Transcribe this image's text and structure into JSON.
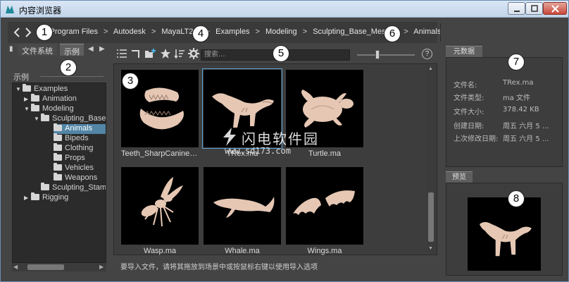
{
  "window": {
    "title": "内容浏览器"
  },
  "pathbar": {
    "crumbs": [
      "Program Files",
      "Autodesk",
      "MayaLT2...",
      "Examples",
      "Modeling",
      "Sculpting_Base_Meshes",
      "Animals"
    ],
    "separator": ">"
  },
  "left_panel": {
    "tabs": [
      "文件系统",
      "示例"
    ],
    "section_label": "示例",
    "tree": [
      {
        "label": "Examples",
        "depth": 0,
        "expanded": true
      },
      {
        "label": "Animation",
        "depth": 1,
        "expanded": false
      },
      {
        "label": "Modeling",
        "depth": 1,
        "expanded": true
      },
      {
        "label": "Sculpting_Base_Meshes",
        "depth": 2,
        "expanded": true
      },
      {
        "label": "Animals",
        "depth": 3,
        "selected": true
      },
      {
        "label": "Bipeds",
        "depth": 3
      },
      {
        "label": "Clothing",
        "depth": 3
      },
      {
        "label": "Props",
        "depth": 3
      },
      {
        "label": "Vehicles",
        "depth": 3
      },
      {
        "label": "Weapons",
        "depth": 3
      },
      {
        "label": "Sculpting_Stamps",
        "depth": 2
      },
      {
        "label": "Rigging",
        "depth": 0,
        "expanded": false
      }
    ]
  },
  "center_panel": {
    "search_placeholder": "搜索...",
    "thumbnails": [
      {
        "label": "Teeth_SharpCanines....",
        "selected": false
      },
      {
        "label": "TRex.ma",
        "selected": true
      },
      {
        "label": "Turtle.ma",
        "selected": false
      },
      {
        "label": "Wasp.ma",
        "selected": false
      },
      {
        "label": "Whale.ma",
        "selected": false
      },
      {
        "label": "Wings.ma",
        "selected": false
      }
    ],
    "status": "要导入文件，请将其拖放到场景中或按鼠标右键以使用导入选项",
    "help": "?"
  },
  "metadata": {
    "tab": "元数据",
    "rows": [
      {
        "key": "文件名:",
        "value": "TRex.ma"
      },
      {
        "key": "文件类型:",
        "value": "ma 文件"
      },
      {
        "key": "文件大小:",
        "value": "378.42 KB"
      },
      {
        "key": "创建日期:",
        "value": "周五 六月 5 ..."
      },
      {
        "key": "上次修改日期:",
        "value": "周五 六月 5 ..."
      }
    ]
  },
  "preview": {
    "tab": "预览"
  },
  "callouts": [
    "1",
    "2",
    "3",
    "4",
    "5",
    "6",
    "7",
    "8"
  ],
  "watermark": {
    "title": "闪电软件园",
    "url": "www.sd173.com"
  },
  "colors": {
    "panel_bg": "#444444",
    "selection": "#5285a6",
    "model": "#e5c7b4"
  }
}
